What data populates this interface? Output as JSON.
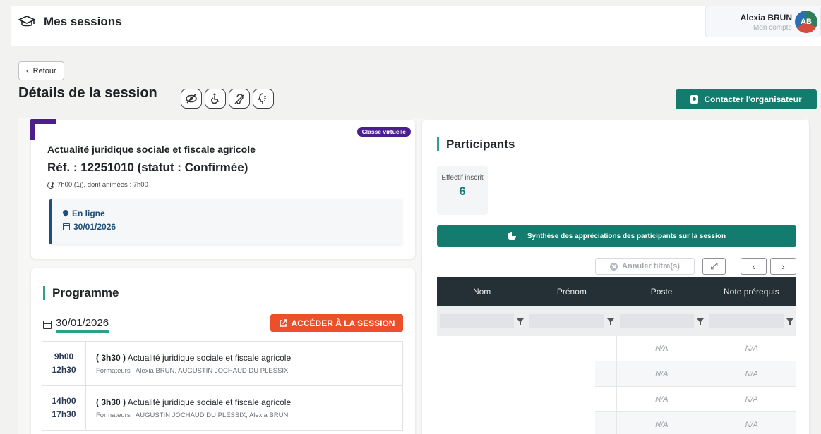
{
  "header": {
    "title": "Mes sessions",
    "user_name": "Alexia BRUN",
    "user_sub": "Mon compte",
    "avatar_initials": "AB"
  },
  "page": {
    "back_label": "Retour",
    "title": "Détails de la session",
    "contact_label": "Contacter l'organisateur",
    "access_icons": [
      "visual-impairment-icon",
      "wheelchair-icon",
      "hearing-impairment-icon",
      "cognitive-disability-icon"
    ]
  },
  "session": {
    "badge": "Classe virtuelle",
    "name": "Actualité juridique sociale et fiscale agricole",
    "ref": "Réf. : 12251010 (statut : Confirmée)",
    "duration": "7h00 (1j), dont animées : 7h00",
    "location": "En ligne",
    "date": "30/01/2026"
  },
  "programme": {
    "title": "Programme",
    "date": "30/01/2026",
    "access_label": "ACCÉDER À LA SESSION",
    "slots": [
      {
        "start": "9h00",
        "end": "12h30",
        "duration": "( 3h30 )",
        "title": "Actualité juridique sociale et fiscale agricole",
        "trainers": "Formateurs : Alexia BRUN, AUGUSTIN JOCHAUD DU PLESSIX"
      },
      {
        "start": "14h00",
        "end": "17h30",
        "duration": "( 3h30 )",
        "title": "Actualité juridique sociale et fiscale agricole",
        "trainers": "Formateurs : AUGUSTIN JOCHAUD DU PLESSIX, Alexia BRUN"
      }
    ]
  },
  "participants": {
    "title": "Participants",
    "effectif_label": "Effectif inscrit",
    "effectif_value": "6",
    "synthese_label": "Synthèse des appréciations des participants sur la session",
    "annuler_label": "Annuler filtre(s)",
    "columns": [
      "Nom",
      "Prénom",
      "Poste",
      "Note prérequis"
    ],
    "rows": [
      [
        "",
        "",
        "N/A",
        "N/A"
      ],
      [
        "",
        "",
        "N/A",
        "N/A"
      ],
      [
        "",
        "",
        "N/A",
        "N/A"
      ],
      [
        "",
        "",
        "N/A",
        "N/A"
      ]
    ]
  },
  "colors": {
    "teal": "#137c6f",
    "purple": "#4b1f8e",
    "orange": "#ec4f2b",
    "navy": "#1e4f78",
    "grid_header": "#243036"
  }
}
